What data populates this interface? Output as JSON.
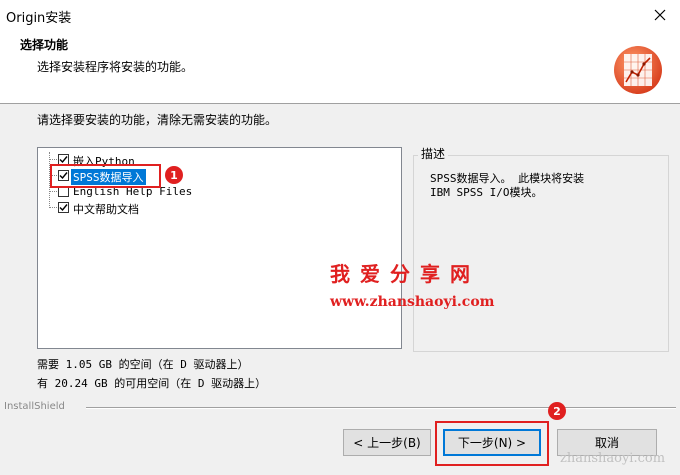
{
  "window": {
    "title": "Origin安装"
  },
  "header": {
    "title": "选择功能",
    "subtitle": "选择安装程序将安装的功能。"
  },
  "instruction": "请选择要安装的功能，清除无需安装的功能。",
  "features": [
    {
      "label": "嵌入Python",
      "checked": true
    },
    {
      "label": "SPSS数据导入",
      "checked": true,
      "selected": true
    },
    {
      "label": "English Help Files",
      "checked": false
    },
    {
      "label": "中文帮助文档",
      "checked": true
    }
  ],
  "description": {
    "legend": "描述",
    "line1": "SPSS数据导入。 此模块将安装",
    "line2": "IBM SPSS I/O模块。"
  },
  "space": {
    "required": "需要 1.05 GB 的空间（在 D 驱动器上）",
    "available": "有 20.24 GB 的可用空间（在 D 驱动器上）"
  },
  "footer": {
    "brand": "InstallShield"
  },
  "buttons": {
    "back": "< 上一步(B)",
    "next": "下一步(N) >",
    "cancel": "取消"
  },
  "markers": {
    "one": "1",
    "two": "2"
  },
  "watermark": {
    "title": "我爱分享网",
    "url": "www.zhanshaoyi.com",
    "corner": "zhanshaoyi.com"
  },
  "icons": {
    "close": "close-icon",
    "logo": "origin-logo-icon"
  },
  "colors": {
    "selection": "#0078d7",
    "highlight": "#e02020"
  }
}
